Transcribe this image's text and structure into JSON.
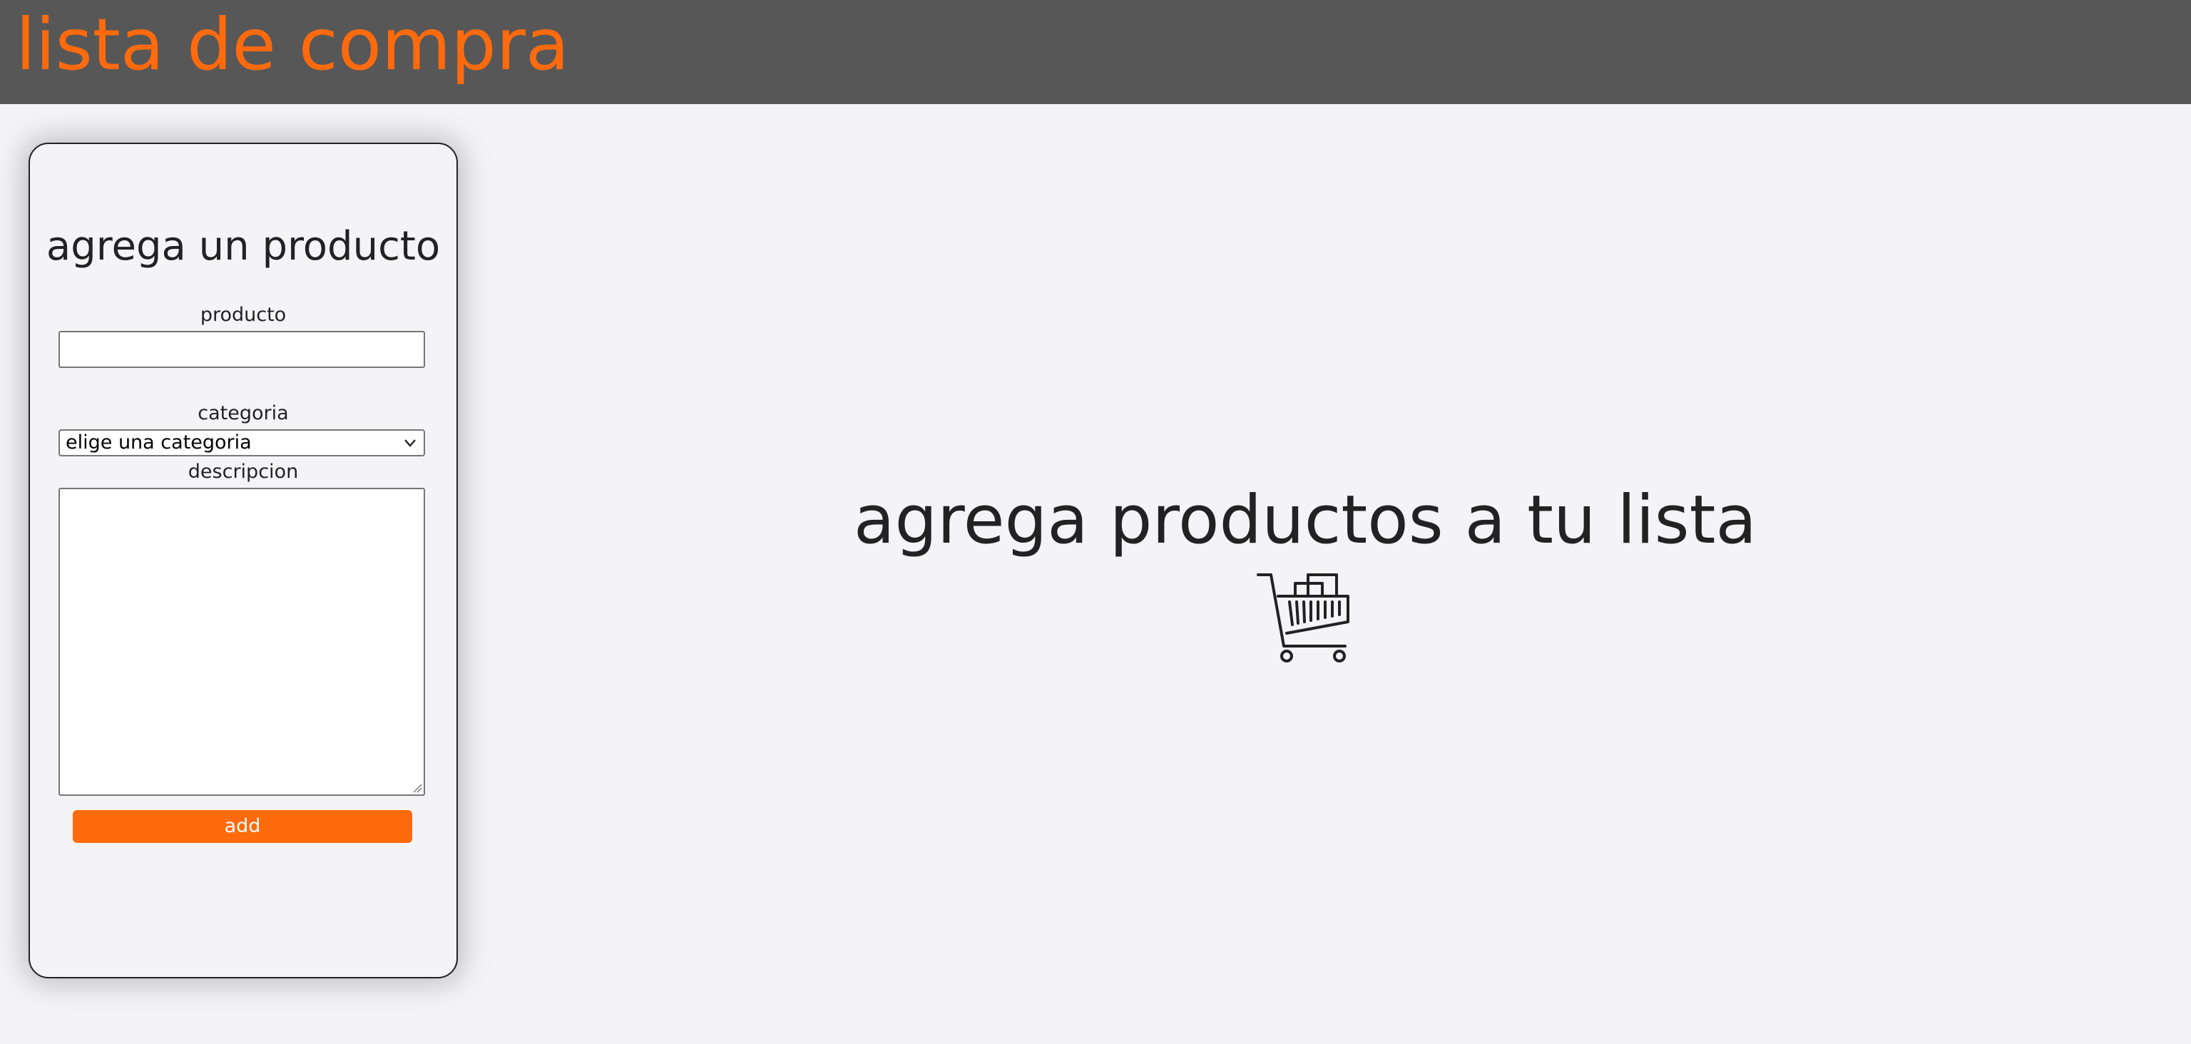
{
  "header": {
    "title": "lista de compra"
  },
  "form": {
    "title": "agrega un producto",
    "product_label": "producto",
    "product_value": "",
    "category_label": "categoria",
    "category_selected": "elige una categoria",
    "description_label": "descripcion",
    "description_value": "",
    "add_label": "add"
  },
  "main": {
    "empty_title": "agrega productos a tu lista",
    "empty_icon": "shopping-cart-icon"
  },
  "colors": {
    "brand": "#ff6a0d",
    "header_bg": "#575757",
    "page_bg": "#f4f4f6",
    "text": "#222222"
  }
}
